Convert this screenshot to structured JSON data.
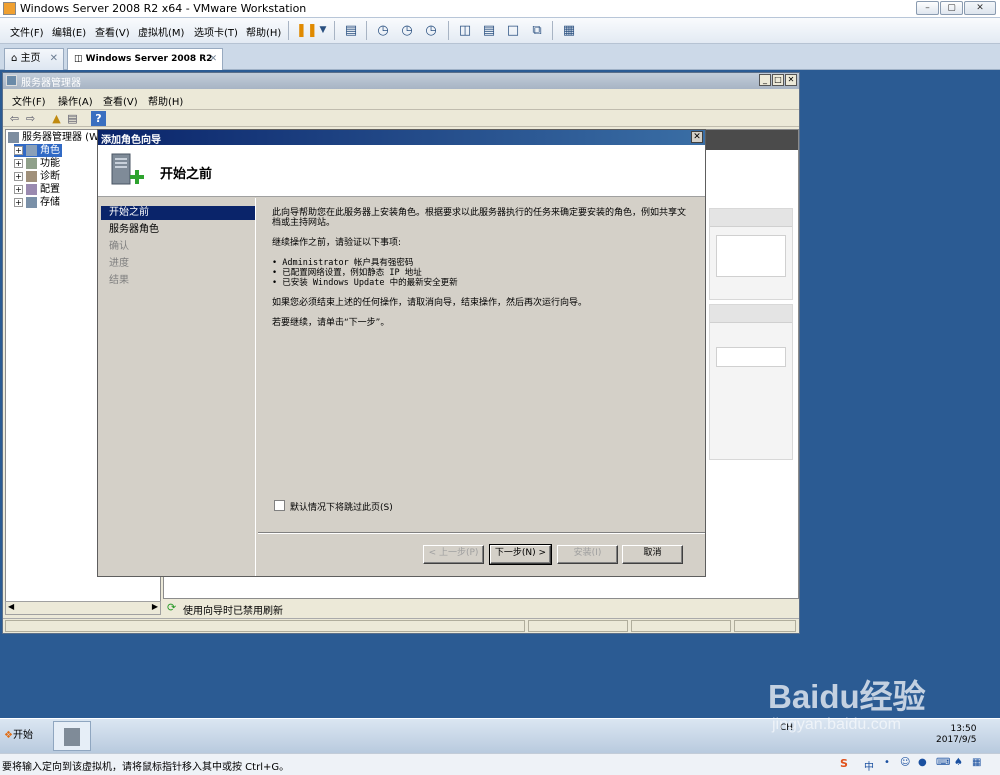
{
  "host": {
    "window_title": "Windows Server 2008 R2 x64 - VMware Workstation",
    "menu": [
      "文件(F)",
      "编辑(E)",
      "查看(V)",
      "虚拟机(M)",
      "选项卡(T)",
      "帮助(H)"
    ],
    "tabs": [
      {
        "label": "主页"
      },
      {
        "label": "Windows Server 2008 R2 ..."
      }
    ],
    "status_message": "要将输入定向到该虚拟机，请将鼠标指针移入其中或按 Ctrl+G。"
  },
  "server_manager": {
    "title": "服务器管理器",
    "menu": [
      "文件(F)",
      "操作(A)",
      "查看(V)",
      "帮助(H)"
    ],
    "tree_root": "服务器管理器 (W",
    "tree": [
      "角色",
      "功能",
      "诊断",
      "配置",
      "存储"
    ],
    "status_text": "使用向导时已禁用刷新"
  },
  "wizard": {
    "title": "添加角色向导",
    "heading": "开始之前",
    "nav": [
      {
        "label": "开始之前",
        "state": "active"
      },
      {
        "label": "服务器角色",
        "state": "normal"
      },
      {
        "label": "确认",
        "state": "disabled"
      },
      {
        "label": "进度",
        "state": "disabled"
      },
      {
        "label": "结果",
        "state": "disabled"
      }
    ],
    "body": {
      "intro": "此向导帮助您在此服务器上安装角色。根据要求以此服务器执行的任务来确定要安装的角色，例如共享文档或主持网站。",
      "verify": "继续操作之前，请验证以下事项:",
      "bullets": [
        "Administrator 帐户具有强密码",
        "已配置网络设置，例如静态 IP 地址",
        "已安装 Windows Update 中的最新安全更新"
      ],
      "exit_note": "如果您必须结束上述的任何操作，请取消向导，结束操作，然后再次运行向导。",
      "continue_note": "若要继续，请单击“下一步”。"
    },
    "skip_checkbox": {
      "label": "默认情况下将跳过此页(S)",
      "checked": false
    },
    "buttons": {
      "prev": "< 上一步(P)",
      "next": "下一步(N) >",
      "install": "安装(I)",
      "cancel": "取消"
    }
  },
  "taskbar": {
    "start_label": "开始",
    "tray_lang": "CH",
    "clock_time": "13:50",
    "clock_date": "2017/9/5"
  },
  "watermark": {
    "brand": "Baidu经验",
    "url": "jingyan.baidu.com"
  },
  "colors": {
    "guest_desktop": "#2b5b93",
    "wizard_nav_active": "#0a246a",
    "wizard_face": "#d4d0c8"
  }
}
